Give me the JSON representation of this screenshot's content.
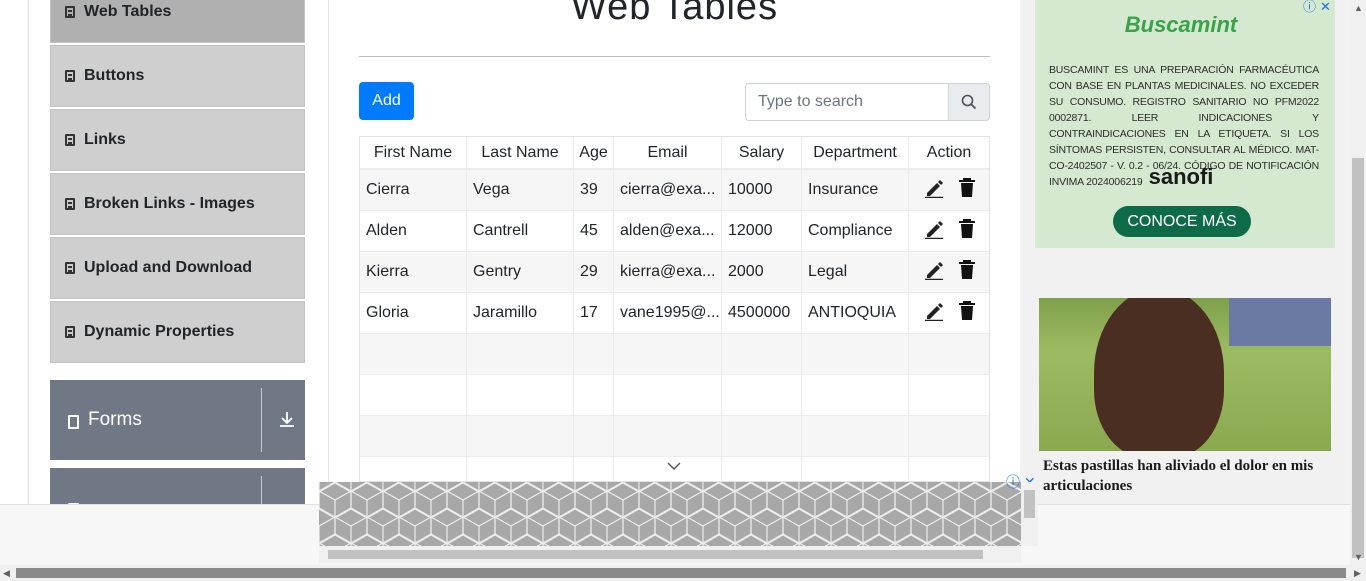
{
  "sidebar": {
    "items": [
      {
        "label": "Web Tables",
        "active": true
      },
      {
        "label": "Buttons",
        "active": false
      },
      {
        "label": "Links",
        "active": false
      },
      {
        "label": "Broken Links - Images",
        "active": false
      },
      {
        "label": "Upload and Download",
        "active": false
      },
      {
        "label": "Dynamic Properties",
        "active": false
      }
    ],
    "groups": [
      {
        "label": "Forms"
      }
    ]
  },
  "main": {
    "title": "Web Tables",
    "add_label": "Add",
    "search_placeholder": "Type to search",
    "columns": [
      "First Name",
      "Last Name",
      "Age",
      "Email",
      "Salary",
      "Department",
      "Action"
    ],
    "rows": [
      [
        "Cierra",
        "Vega",
        "39",
        "cierra@exa...",
        "10000",
        "Insurance"
      ],
      [
        "Alden",
        "Cantrell",
        "45",
        "alden@exa...",
        "12000",
        "Compliance"
      ],
      [
        "Kierra",
        "Gentry",
        "29",
        "kierra@exa...",
        "2000",
        "Legal"
      ],
      [
        "Gloria",
        "Jaramillo",
        "17",
        "vane1995@...",
        "4500000",
        "ANTIOQUIA"
      ]
    ],
    "empty_rows": 4
  },
  "ads": {
    "right_top": {
      "brand": "Buscamint",
      "disclaimer": "BUSCAMINT ES UNA PREPARACIÓN FARMACÉUTICA CON BASE EN PLANTAS MEDICINALES. NO EXCEDER SU CONSUMO. REGISTRO SANITARIO NO PFM2022 0002871. LEER INDICACIONES Y CONTRAINDICACIONES EN LA ETIQUETA. SI LOS SÍNTOMAS PERSISTEN, CONSULTAR AL MÉDICO. MAT-CO-2402507 - V. 0.2 - 06/24. CÓDIGO DE NOTIFICACIÓN INVIMA 2024006219",
      "sponsor": "sanofi",
      "cta": "CONOCE MÁS"
    },
    "right_bottom": {
      "caption": "Estas pastillas han aliviado el dolor en mis articulaciones"
    }
  },
  "colors": {
    "primary": "#007bff",
    "sidebar_item": "#cfcfcf",
    "sidebar_active": "#b0b0b0",
    "group_header": "#707885",
    "ad_green": "#0d6b48"
  }
}
